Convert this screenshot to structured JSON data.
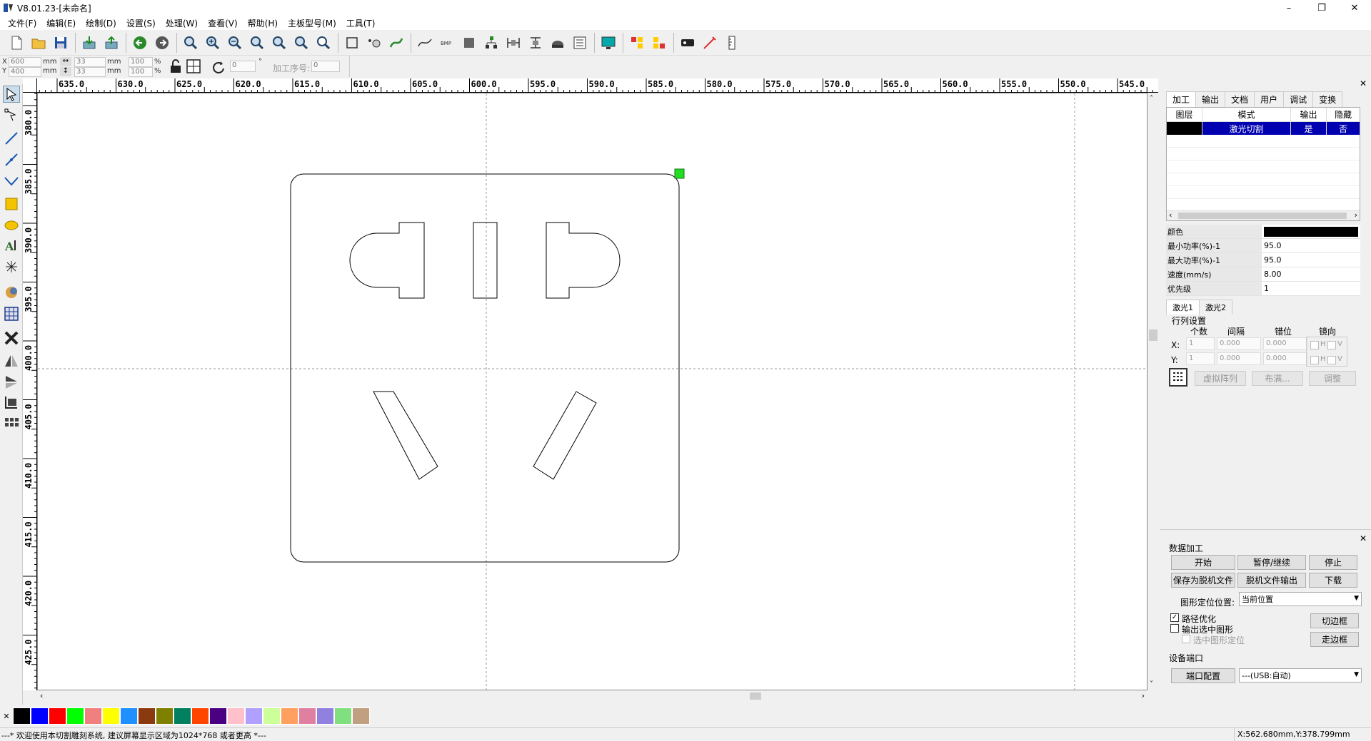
{
  "window": {
    "title": "V8.01.23-[未命名]",
    "min": "–",
    "max": "❐",
    "close": "✕"
  },
  "menu": [
    "文件(F)",
    "编辑(E)",
    "绘制(D)",
    "设置(S)",
    "处理(W)",
    "查看(V)",
    "帮助(H)",
    "主板型号(M)",
    "工具(T)"
  ],
  "coords": {
    "x_label": "X",
    "y_label": "Y",
    "x_value": "600",
    "y_value": "400",
    "unit": "mm",
    "w_value": "33",
    "h_value": "33",
    "sx_value": "100",
    "sy_value": "100",
    "pct": "%",
    "rotate_value": "0",
    "deg": "°",
    "proc_order_label": "加工序号:",
    "proc_order_value": "0"
  },
  "ruler": {
    "h": [
      "635.0",
      "630.0",
      "625.0",
      "620.0",
      "615.0",
      "610.0",
      "605.0",
      "600.0",
      "595.0",
      "590.0",
      "585.0",
      "580.0",
      "575.0",
      "570.0",
      "565.0",
      "560.0",
      "555.0",
      "550.0",
      "545.0"
    ],
    "v": [
      "380.0",
      "385.0",
      "390.0",
      "395.0",
      "400.0",
      "405.0",
      "410.0",
      "415.0",
      "420.0",
      "425.0"
    ]
  },
  "panel": {
    "tabs": [
      "加工",
      "输出",
      "文档",
      "用户",
      "调试",
      "变换"
    ],
    "layer_headers": [
      "图层",
      "模式",
      "输出",
      "隐藏"
    ],
    "layer_row": {
      "mode": "激光切割",
      "output": "是",
      "hidden": "否",
      "color": "#000000"
    },
    "props": [
      {
        "label": "颜色",
        "value": ""
      },
      {
        "label": "最小功率(%)-1",
        "value": "95.0"
      },
      {
        "label": "最大功率(%)-1",
        "value": "95.0"
      },
      {
        "label": "速度(mm/s)",
        "value": "8.00"
      },
      {
        "label": "优先级",
        "value": "1"
      }
    ],
    "laser_tabs": [
      "激光1",
      "激光2"
    ],
    "array": {
      "title": "行列设置",
      "col_count": "个数",
      "col_gap": "间隔",
      "col_offset": "错位",
      "col_mirror": "镜向",
      "x_label": "X:",
      "y_label": "Y:",
      "x_count": "1",
      "x_gap": "0.000",
      "x_offset": "0.000",
      "y_count": "1",
      "y_gap": "0.000",
      "y_offset": "0.000",
      "h": "H",
      "v": "V",
      "virtual_btn": "虚拟阵列",
      "fill_btn": "布满...",
      "adjust_btn": "调整"
    },
    "data": {
      "title": "数据加工",
      "start": "开始",
      "pause": "暂停/继续",
      "stop": "停止",
      "save_offline": "保存为脱机文件",
      "offline_output": "脱机文件输出",
      "download": "下载",
      "pos_label": "图形定位位置:",
      "pos_value": "当前位置",
      "path_opt": "路径优化",
      "output_sel": "输出选中图形",
      "sel_pos": "选中图形定位",
      "cut_frame": "切边框",
      "walk_frame": "走边框",
      "port_title": "设备端口",
      "port_cfg": "端口配置",
      "port_value": "---(USB:自动)"
    }
  },
  "palette": [
    "#000000",
    "#0000ff",
    "#ff0000",
    "#00ff00",
    "#f08080",
    "#ffff00",
    "#1e90ff",
    "#8b3a0f",
    "#808000",
    "#008060",
    "#ff4500",
    "#4b0082",
    "#ffc0cb",
    "#b0a0ff",
    "#ccff99",
    "#ffa060",
    "#e080a0",
    "#9080e0",
    "#80e080",
    "#c0a080"
  ],
  "status": {
    "message": "---* 欢迎使用本切割雕刻系统, 建议屏幕显示区域为1024*768 或者更高 *---",
    "coords": "X:562.680mm,Y:378.799mm"
  }
}
